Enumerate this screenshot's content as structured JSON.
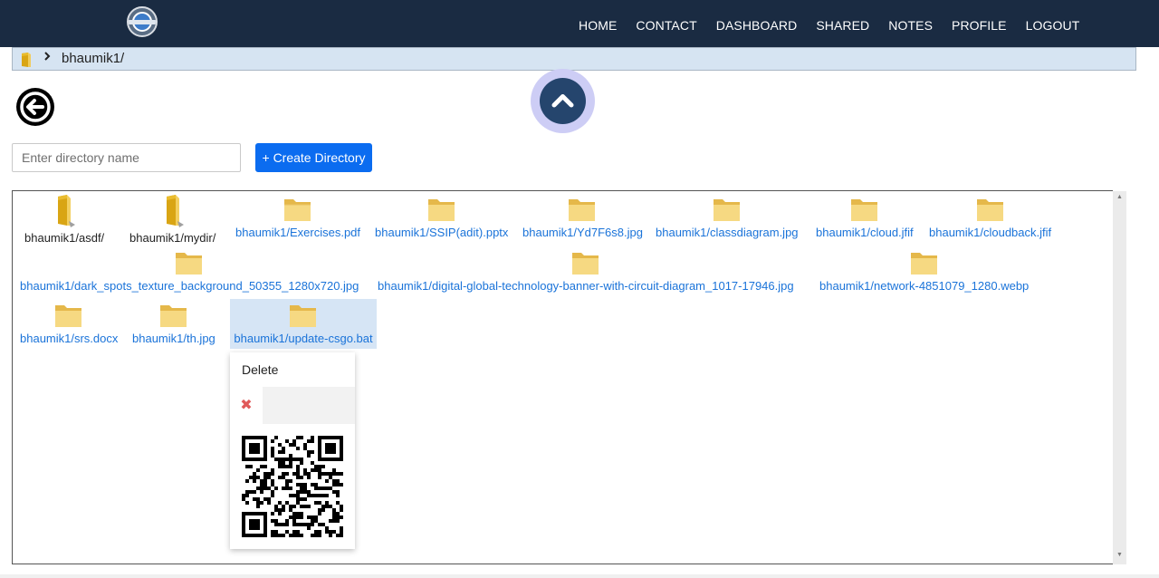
{
  "navbar": {
    "logo_icon": "circular-badge-logo-icon",
    "items": [
      {
        "label": "HOME"
      },
      {
        "label": "CONTACT"
      },
      {
        "label": "DASHBOARD"
      },
      {
        "label": "SHARED"
      },
      {
        "label": "NOTES"
      },
      {
        "label": "PROFILE"
      },
      {
        "label": "LOGOUT"
      }
    ]
  },
  "breadcrumb": {
    "folder_icon": "folder-icon",
    "separator_icon": "chevron-right-icon",
    "path": "bhaumik1/"
  },
  "controls": {
    "back_icon": "arrow-left-circle-icon",
    "scroll_top_icon": "chevron-up-icon",
    "dir_input_value": "",
    "dir_input_placeholder": "Enter directory name",
    "create_button_label": "+ Create Directory"
  },
  "files": {
    "items": [
      {
        "name": "bhaumik1/asdf/",
        "type": "dir",
        "icon": "folder-open-icon"
      },
      {
        "name": "bhaumik1/mydir/",
        "type": "dir",
        "icon": "folder-open-icon"
      },
      {
        "name": "bhaumik1/Exercises.pdf",
        "type": "file",
        "icon": "folder-icon"
      },
      {
        "name": "bhaumik1/SSIP(adit).pptx",
        "type": "file",
        "icon": "folder-icon"
      },
      {
        "name": "bhaumik1/Yd7F6s8.jpg",
        "type": "file",
        "icon": "folder-icon"
      },
      {
        "name": "bhaumik1/classdiagram.jpg",
        "type": "file",
        "icon": "folder-icon"
      },
      {
        "name": "bhaumik1/cloud.jfif",
        "type": "file",
        "icon": "folder-icon"
      },
      {
        "name": "bhaumik1/cloudback.jfif",
        "type": "file",
        "icon": "folder-icon"
      },
      {
        "name": "bhaumik1/dark_spots_texture_background_50355_1280x720.jpg",
        "type": "file",
        "icon": "folder-icon"
      },
      {
        "name": "bhaumik1/digital-global-technology-banner-with-circuit-diagram_1017-17946.jpg",
        "type": "file",
        "icon": "folder-icon"
      },
      {
        "name": "bhaumik1/network-4851079_1280.webp",
        "type": "file",
        "icon": "folder-icon"
      },
      {
        "name": "bhaumik1/srs.docx",
        "type": "file",
        "icon": "folder-icon"
      },
      {
        "name": "bhaumik1/th.jpg",
        "type": "file",
        "icon": "folder-icon"
      },
      {
        "name": "bhaumik1/update-csgo.bat",
        "type": "file",
        "icon": "folder-icon",
        "selected": true
      }
    ]
  },
  "context_menu": {
    "delete_label": "Delete",
    "close_icon": "close-x-icon",
    "qr_icon": "qr-code-icon"
  },
  "colors": {
    "navbar_bg": "#1a2b42",
    "breadcrumb_bg": "#d6e4f2",
    "primary_button": "#0b6cf0",
    "file_link": "#1a73d9",
    "scroll_top_ring": "#cdcdf5",
    "scroll_top_core": "#25456d",
    "close_red": "#e05a5a"
  }
}
